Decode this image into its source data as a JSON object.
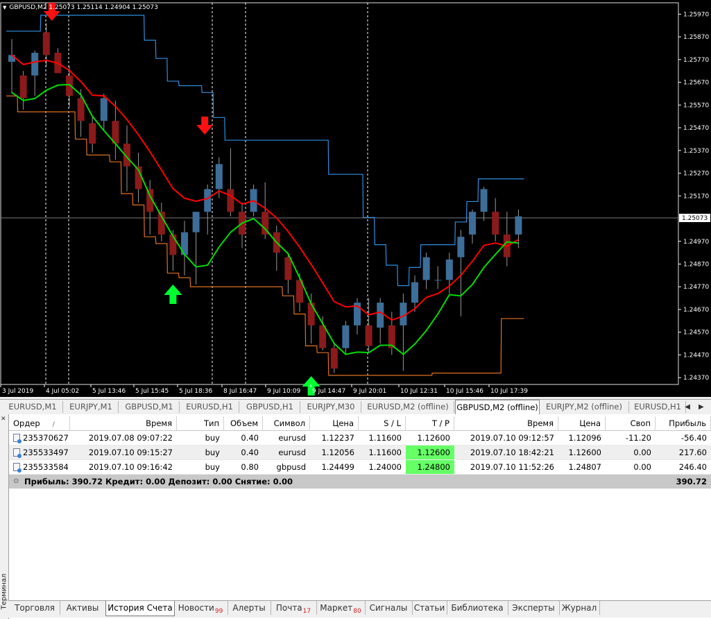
{
  "chart": {
    "title": "GBPUSD,M2  1.25073 1.25114 1.24904 1.25073",
    "current_price": "1.25073",
    "price_labels": [
      "1.25970",
      "1.25870",
      "1.25770",
      "1.25670",
      "1.25570",
      "1.25470",
      "1.25370",
      "1.25270",
      "1.25170",
      "1.24970",
      "1.24870",
      "1.24770",
      "1.24670",
      "1.24570",
      "1.24470",
      "1.24370"
    ],
    "time_labels": [
      "3 Jul 2019",
      "4 Jul 05:02",
      "5 Jul 13:46",
      "5 Jul 15:45",
      "5 Jul 18:36",
      "8 Jul 16:47",
      "9 Jul 10:09",
      "9 Jul 14:47",
      "9 Jul 20:01",
      "10 Jul 12:31",
      "10 Jul 15:46",
      "10 Jul 17:39"
    ],
    "colors": {
      "bull": "#3d6e99",
      "bear": "#8b1a1a",
      "red_line": "#ff0000",
      "green_line": "#00dd00",
      "blue_band": "#2f8fe0",
      "orange_band": "#e07020",
      "down_arrow": "#ff1010",
      "up_arrow": "#00ff30"
    },
    "candles": [
      {
        "o": 1.2576,
        "h": 1.2586,
        "l": 1.2562,
        "c": 1.2579
      },
      {
        "o": 1.257,
        "h": 1.2572,
        "l": 1.2555,
        "c": 1.256
      },
      {
        "o": 1.257,
        "h": 1.2581,
        "l": 1.2561,
        "c": 1.258
      },
      {
        "o": 1.2589,
        "h": 1.2593,
        "l": 1.2574,
        "c": 1.2579
      },
      {
        "o": 1.258,
        "h": 1.2582,
        "l": 1.2571,
        "c": 1.2571
      },
      {
        "o": 1.257,
        "h": 1.2574,
        "l": 1.2556,
        "c": 1.2561
      },
      {
        "o": 1.256,
        "h": 1.2564,
        "l": 1.2543,
        "c": 1.255
      },
      {
        "o": 1.2549,
        "h": 1.2552,
        "l": 1.2536,
        "c": 1.254
      },
      {
        "o": 1.255,
        "h": 1.2562,
        "l": 1.2546,
        "c": 1.256
      },
      {
        "o": 1.255,
        "h": 1.2559,
        "l": 1.2533,
        "c": 1.254
      },
      {
        "o": 1.254,
        "h": 1.2548,
        "l": 1.2519,
        "c": 1.253
      },
      {
        "o": 1.253,
        "h": 1.2536,
        "l": 1.2514,
        "c": 1.252
      },
      {
        "o": 1.252,
        "h": 1.2524,
        "l": 1.25,
        "c": 1.251
      },
      {
        "o": 1.251,
        "h": 1.2514,
        "l": 1.2497,
        "c": 1.25
      },
      {
        "o": 1.25,
        "h": 1.2502,
        "l": 1.2484,
        "c": 1.2491
      },
      {
        "o": 1.2491,
        "h": 1.2506,
        "l": 1.2482,
        "c": 1.2501
      },
      {
        "o": 1.2501,
        "h": 1.2508,
        "l": 1.2478,
        "c": 1.251
      },
      {
        "o": 1.251,
        "h": 1.2522,
        "l": 1.25,
        "c": 1.252
      },
      {
        "o": 1.252,
        "h": 1.2534,
        "l": 1.2516,
        "c": 1.2531
      },
      {
        "o": 1.252,
        "h": 1.2538,
        "l": 1.2508,
        "c": 1.251
      },
      {
        "o": 1.251,
        "h": 1.2514,
        "l": 1.2494,
        "c": 1.25
      },
      {
        "o": 1.251,
        "h": 1.2522,
        "l": 1.2508,
        "c": 1.252
      },
      {
        "o": 1.251,
        "h": 1.2523,
        "l": 1.2498,
        "c": 1.25
      },
      {
        "o": 1.2501,
        "h": 1.2504,
        "l": 1.2484,
        "c": 1.2492
      },
      {
        "o": 1.249,
        "h": 1.2492,
        "l": 1.2474,
        "c": 1.248
      },
      {
        "o": 1.248,
        "h": 1.2483,
        "l": 1.2466,
        "c": 1.247
      },
      {
        "o": 1.247,
        "h": 1.2474,
        "l": 1.2452,
        "c": 1.246
      },
      {
        "o": 1.246,
        "h": 1.2464,
        "l": 1.2449,
        "c": 1.245
      },
      {
        "o": 1.245,
        "h": 1.2452,
        "l": 1.2439,
        "c": 1.2441
      },
      {
        "o": 1.245,
        "h": 1.2462,
        "l": 1.2447,
        "c": 1.246
      },
      {
        "o": 1.246,
        "h": 1.2472,
        "l": 1.2456,
        "c": 1.247
      },
      {
        "o": 1.246,
        "h": 1.2472,
        "l": 1.2448,
        "c": 1.2451
      },
      {
        "o": 1.2459,
        "h": 1.2472,
        "l": 1.2452,
        "c": 1.247
      },
      {
        "o": 1.246,
        "h": 1.2466,
        "l": 1.2447,
        "c": 1.245
      },
      {
        "o": 1.246,
        "h": 1.2474,
        "l": 1.244,
        "c": 1.247
      },
      {
        "o": 1.247,
        "h": 1.2482,
        "l": 1.2466,
        "c": 1.2479
      },
      {
        "o": 1.248,
        "h": 1.2492,
        "l": 1.2476,
        "c": 1.249
      },
      {
        "o": 1.248,
        "h": 1.2486,
        "l": 1.2476,
        "c": 1.248
      },
      {
        "o": 1.248,
        "h": 1.2492,
        "l": 1.2474,
        "c": 1.2489
      },
      {
        "o": 1.249,
        "h": 1.2502,
        "l": 1.2464,
        "c": 1.2499
      },
      {
        "o": 1.25,
        "h": 1.2511,
        "l": 1.2496,
        "c": 1.251
      },
      {
        "o": 1.251,
        "h": 1.2521,
        "l": 1.2506,
        "c": 1.252
      },
      {
        "o": 1.251,
        "h": 1.2516,
        "l": 1.2497,
        "c": 1.25
      },
      {
        "o": 1.25,
        "h": 1.251,
        "l": 1.2486,
        "c": 1.249
      },
      {
        "o": 1.25,
        "h": 1.2511,
        "l": 1.2494,
        "c": 1.2508
      }
    ]
  },
  "chart_tabs": [
    "EURUSD,M1",
    "EURJPY,M1",
    "GBPUSD,M1",
    "EURUSD,H1",
    "GBPUSD,H1",
    "EURJPY,M30",
    "EURUSD,M2 (offline)",
    "GBPUSD,M2 (offline)",
    "EURJPY,M2 (offline)",
    "EURUSD,H1"
  ],
  "active_chart_tab": "GBPUSD,M2 (offline)",
  "terminal": {
    "side_label": "Терминал",
    "columns": [
      "Ордер",
      "Время",
      "Тип",
      "Объем",
      "Символ",
      "Цена",
      "S / L",
      "T / P",
      "Время",
      "Цена",
      "Своп",
      "Прибыль"
    ],
    "sort_indicator": "/",
    "rows": [
      {
        "order": "235370627",
        "time": "2019.07.08 09:07:22",
        "type": "buy",
        "volume": "0.40",
        "symbol": "eurusd",
        "price": "1.12237",
        "sl": "1.11600",
        "tp": "1.12600",
        "close_time": "2019.07.10 09:12:57",
        "close_price": "1.12096",
        "swap": "-11.20",
        "profit": "-56.40"
      },
      {
        "order": "235533497",
        "time": "2019.07.10 09:15:27",
        "type": "buy",
        "volume": "0.40",
        "symbol": "eurusd",
        "price": "1.12056",
        "sl": "1.11600",
        "tp": "1.12600",
        "close_time": "2019.07.10 18:42:21",
        "close_price": "1.12600",
        "swap": "0.00",
        "profit": "217.60"
      },
      {
        "order": "235533584",
        "time": "2019.07.10 09:16:42",
        "type": "buy",
        "volume": "0.80",
        "symbol": "gbpusd",
        "price": "1.24499",
        "sl": "1.24000",
        "tp": "1.24800",
        "close_time": "2019.07.10 11:52:26",
        "close_price": "1.24807",
        "swap": "0.00",
        "profit": "246.40"
      }
    ],
    "summary": {
      "text": "Прибыль: 390.72  Кредит: 0.00  Депозит: 0.00  Снятие: 0.00",
      "total": "390.72"
    },
    "bottom_tabs": [
      {
        "label": "Торговля"
      },
      {
        "label": "Активы"
      },
      {
        "label": "История Счета"
      },
      {
        "label": "Новости",
        "badge": "99"
      },
      {
        "label": "Алерты"
      },
      {
        "label": "Почта",
        "badge": "17"
      },
      {
        "label": "Маркет",
        "badge": "80"
      },
      {
        "label": "Сигналы"
      },
      {
        "label": "Статьи"
      },
      {
        "label": "Библиотека"
      },
      {
        "label": "Эксперты"
      },
      {
        "label": "Журнал"
      }
    ],
    "active_bottom_tab": "История Счета"
  }
}
